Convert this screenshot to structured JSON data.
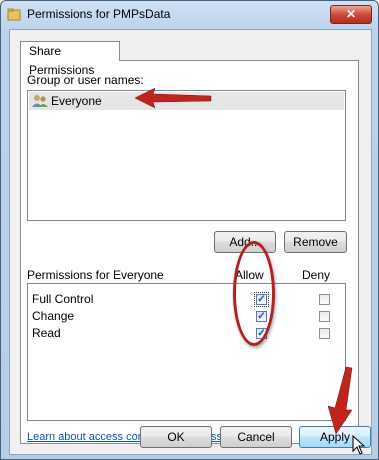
{
  "window": {
    "title": "Permissions for PMPsData",
    "close_glyph": "✕"
  },
  "tabs": [
    {
      "label": "Share Permissions"
    }
  ],
  "group": {
    "label": "Group or user names:",
    "users": [
      {
        "name": "Everyone",
        "icon": "users-icon",
        "selected": true
      }
    ]
  },
  "buttons": {
    "add": "Add...",
    "remove": "Remove",
    "ok": "OK",
    "cancel": "Cancel",
    "apply": "Apply"
  },
  "permissions": {
    "label": "Permissions for Everyone",
    "allow_header": "Allow",
    "deny_header": "Deny",
    "rows": [
      {
        "name": "Full Control",
        "allow": true,
        "deny": false
      },
      {
        "name": "Change",
        "allow": true,
        "deny": false
      },
      {
        "name": "Read",
        "allow": true,
        "deny": false
      }
    ]
  },
  "link": "Learn about access control and permissions",
  "annotation": {
    "color": "#c0241c"
  },
  "check_glyph": "✓"
}
